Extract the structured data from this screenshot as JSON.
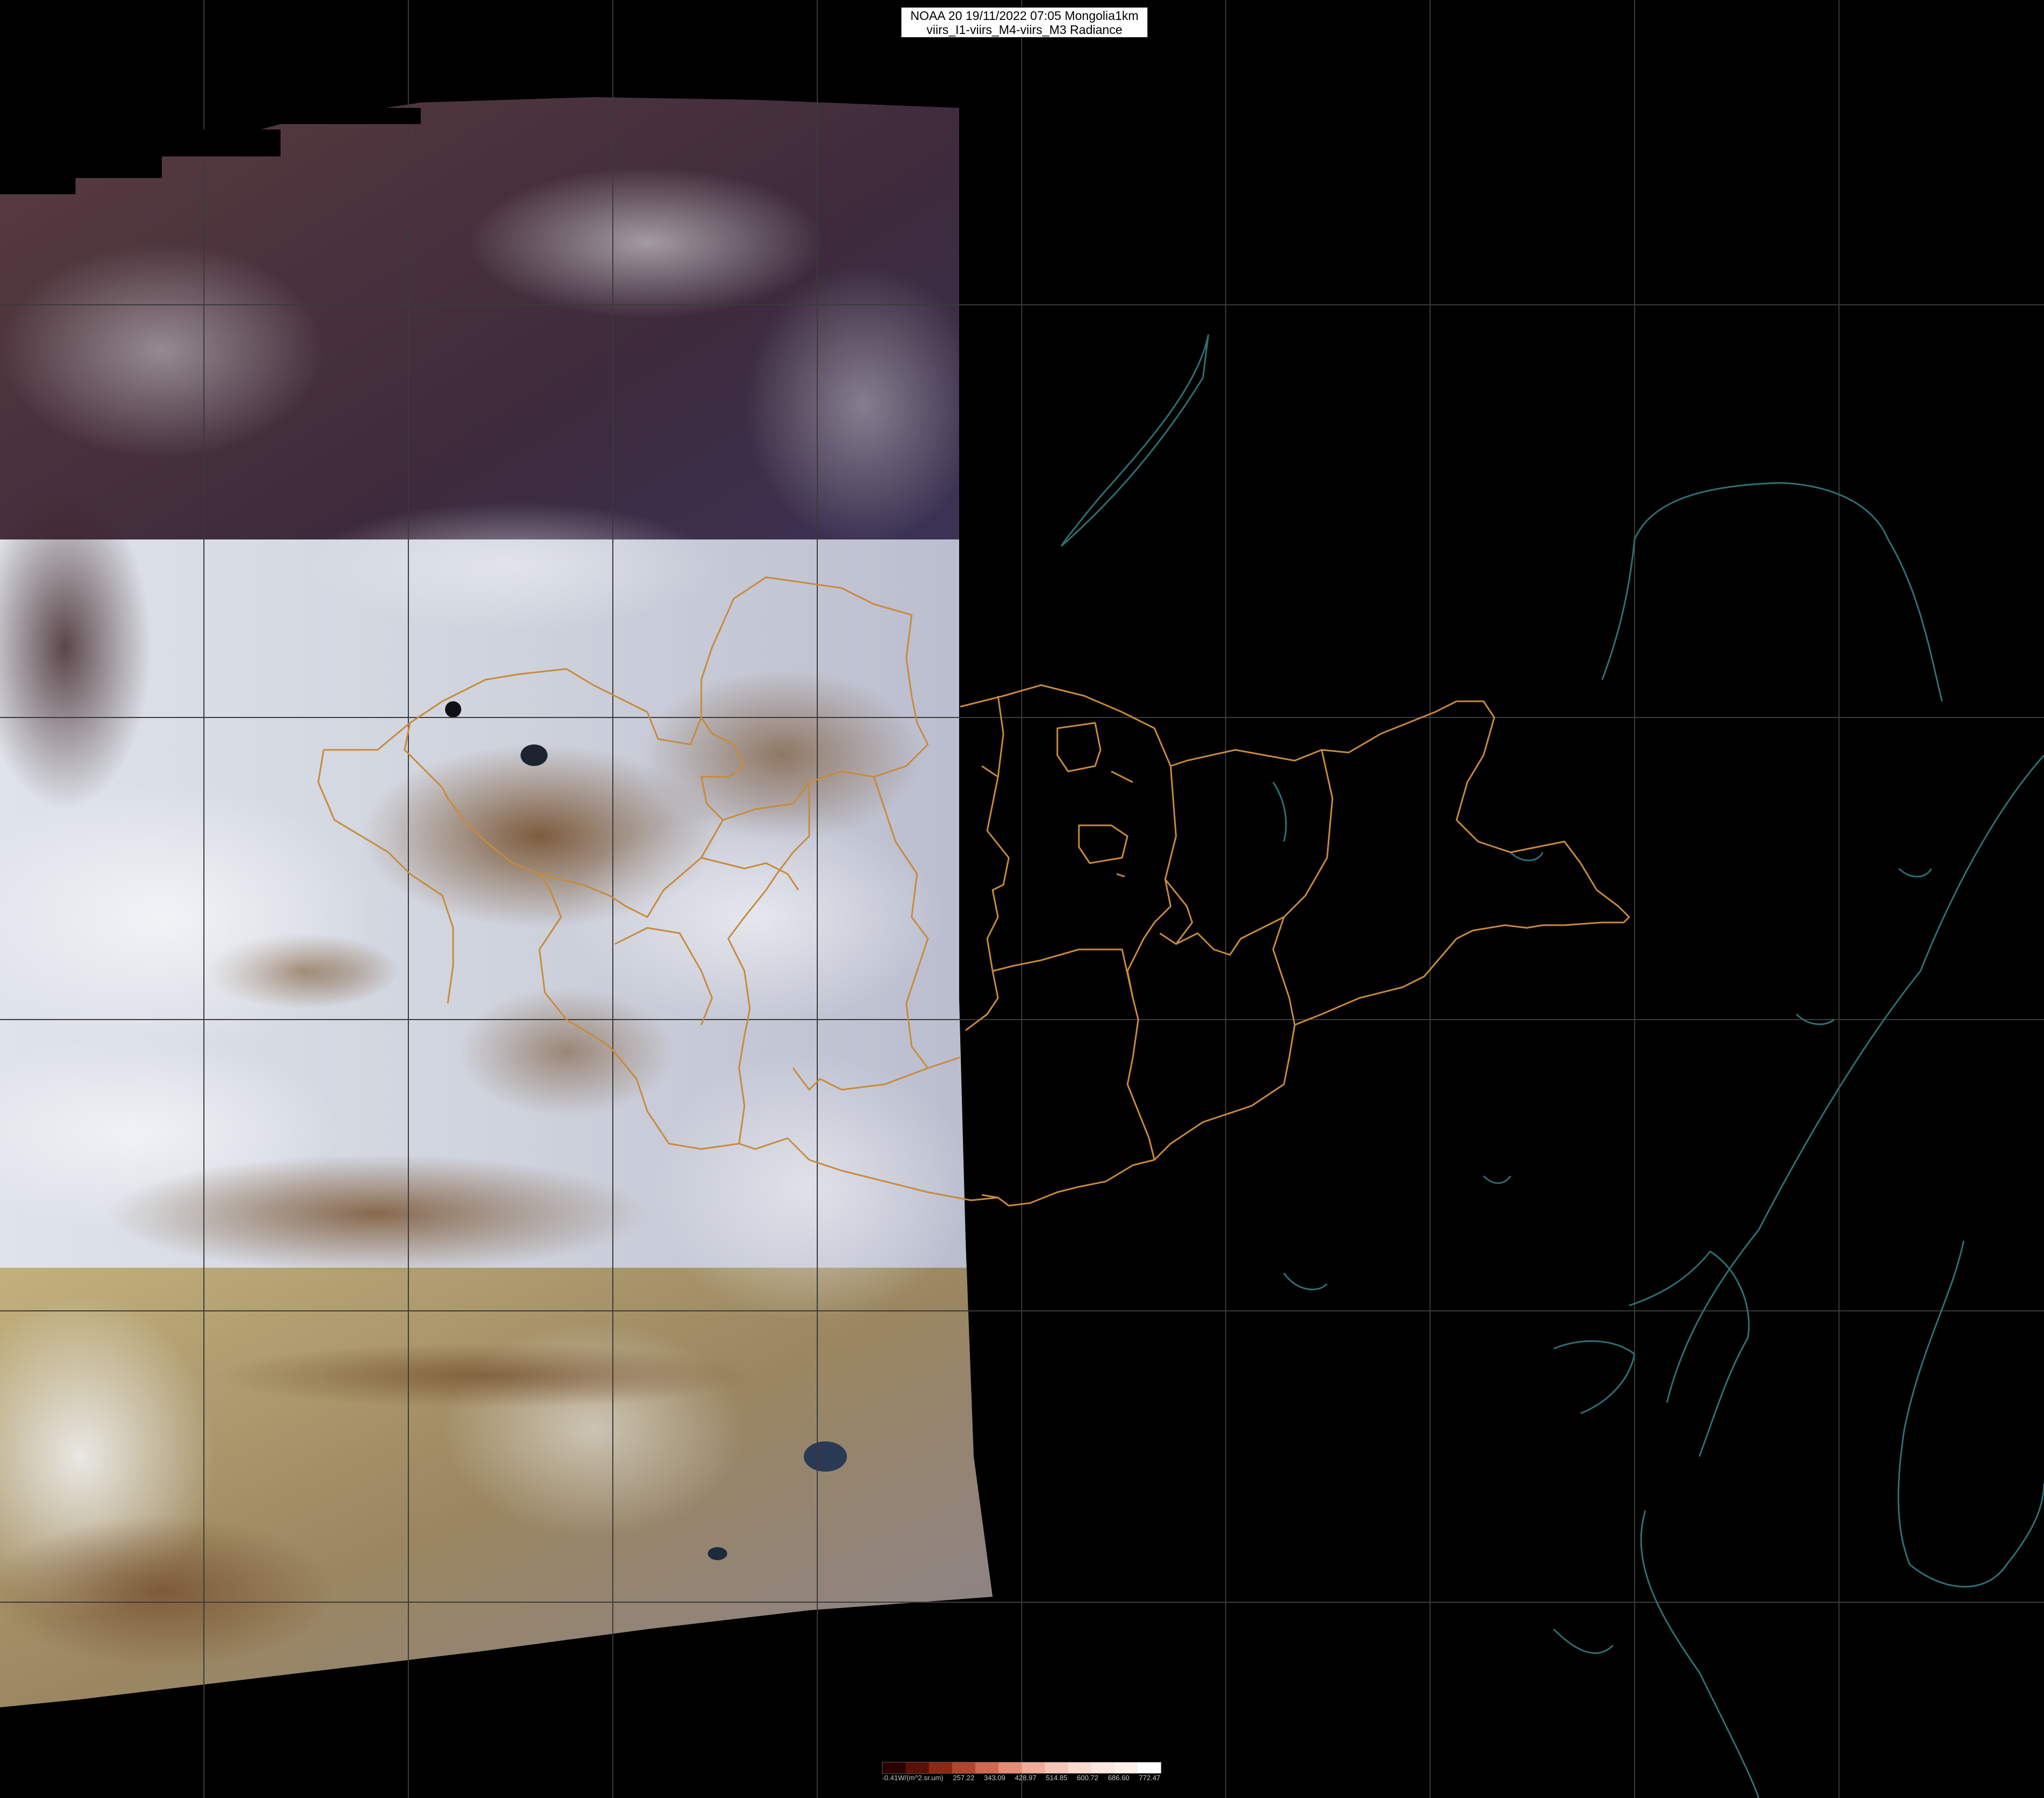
{
  "title": {
    "line1": "NOAA 20 19/11/2022 07:05 Mongolia1km",
    "line2": "viirs_I1-viirs_M4-viirs_M3 Radiance"
  },
  "colorbar": {
    "unit_label": "-0.41W/(m^2.sr.um)",
    "ticks": [
      "257.22",
      "343.09",
      "428.97",
      "514.85",
      "600.72",
      "686.60",
      "772.47"
    ],
    "colors": [
      "#2a0000",
      "#5a1206",
      "#8a2a14",
      "#b0472c",
      "#cf6a4e",
      "#e48d76",
      "#f0ac9a",
      "#f6c6b8",
      "#fad9cf",
      "#fde6de",
      "#fff0ea",
      "#ffffff"
    ]
  },
  "map": {
    "background": "#000000",
    "grid_color": "#3a3a3a",
    "border_color": "#c98a3c",
    "coast_color": "#2f6f74",
    "snow_color": "#e8ecf2",
    "desert_color": "#b8a77a",
    "mountain_color": "#4a2e2e"
  }
}
